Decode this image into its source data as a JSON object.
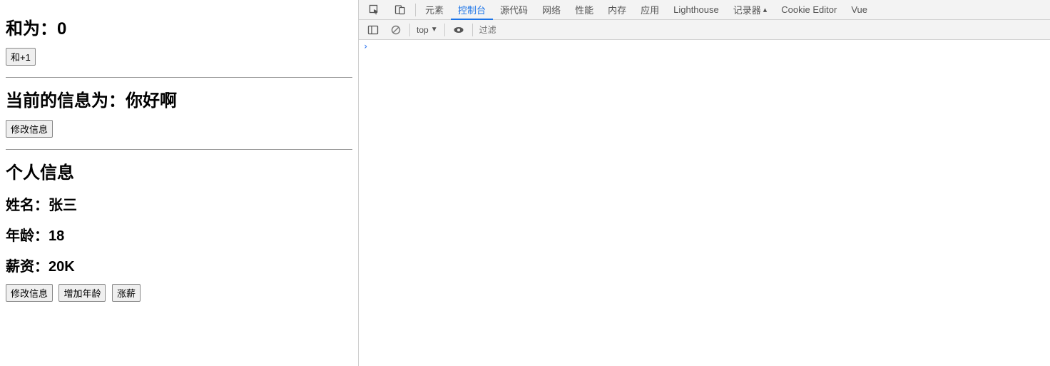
{
  "left": {
    "sum": {
      "label_prefix": "和为：",
      "value": "0",
      "button": "和+1"
    },
    "info": {
      "label_prefix": "当前的信息为：",
      "value": "你好啊",
      "button": "修改信息"
    },
    "person": {
      "heading": "个人信息",
      "name_label": "姓名：",
      "name_value": "张三",
      "age_label": "年龄：",
      "age_value": "18",
      "salary_label": "薪资：",
      "salary_value": "20K",
      "btn_modify": "修改信息",
      "btn_age": "增加年龄",
      "btn_salary": "涨薪"
    }
  },
  "devtools": {
    "tabs": {
      "elements": "元素",
      "console": "控制台",
      "sources": "源代码",
      "network": "网络",
      "performance": "性能",
      "memory": "内存",
      "application": "应用",
      "lighthouse": "Lighthouse",
      "recorder": "记录器",
      "cookie_editor": "Cookie Editor",
      "vue": "Vue"
    },
    "console_toolbar": {
      "context": "top",
      "filter_placeholder": "过滤"
    }
  }
}
